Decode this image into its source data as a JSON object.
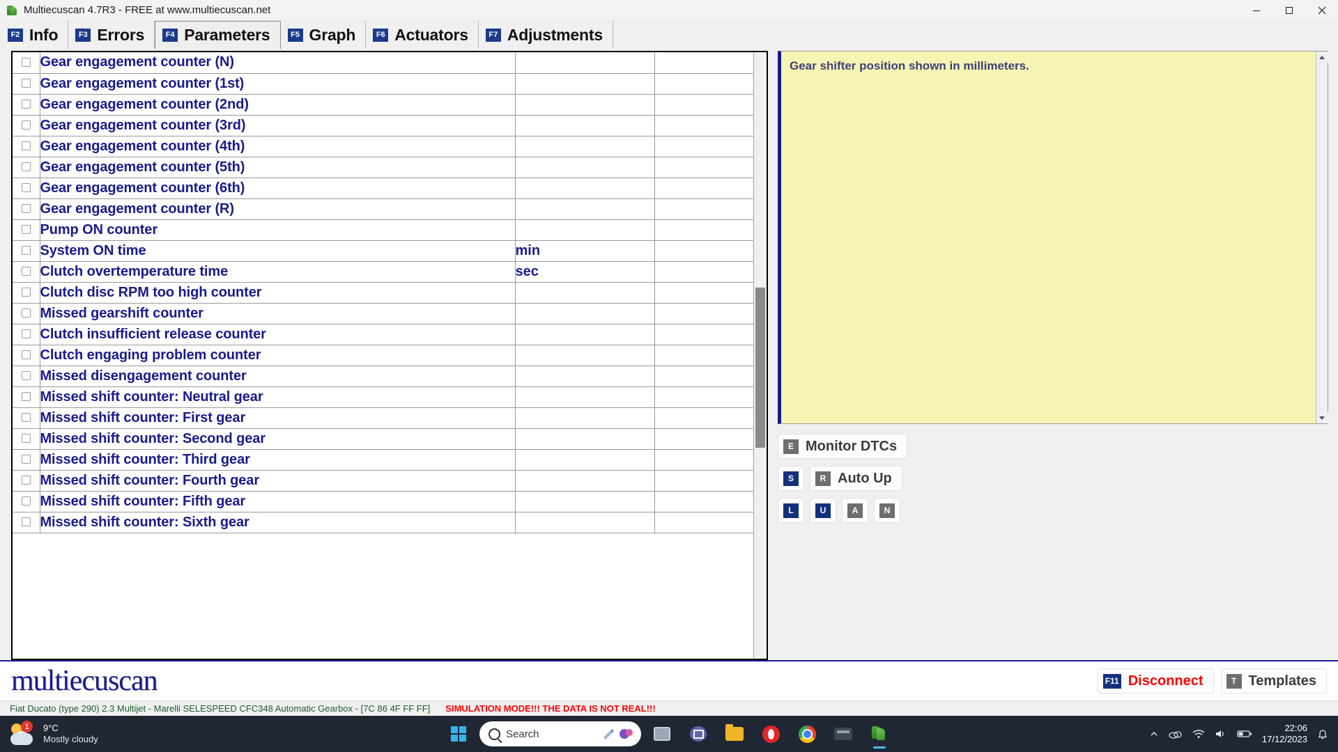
{
  "window": {
    "title": "Multiecuscan 4.7R3 - FREE at www.multiecuscan.net",
    "app_icon": "multiecuscan-leaf-icon",
    "minimize_label": "Minimize",
    "maximize_label": "Maximize",
    "close_label": "Close"
  },
  "tabs": [
    {
      "fkey": "F2",
      "label": "Info",
      "active": false
    },
    {
      "fkey": "F3",
      "label": "Errors",
      "active": false
    },
    {
      "fkey": "F4",
      "label": "Parameters",
      "active": true
    },
    {
      "fkey": "F5",
      "label": "Graph",
      "active": false
    },
    {
      "fkey": "F6",
      "label": "Actuators",
      "active": false
    },
    {
      "fkey": "F7",
      "label": "Adjustments",
      "active": false
    }
  ],
  "grid": {
    "rows": [
      {
        "checked": false,
        "name": "Gear engagement counter (N)",
        "value": "",
        "unit": ""
      },
      {
        "checked": false,
        "name": "Gear engagement counter (1st)",
        "value": "",
        "unit": ""
      },
      {
        "checked": false,
        "name": "Gear engagement counter (2nd)",
        "value": "",
        "unit": ""
      },
      {
        "checked": false,
        "name": "Gear engagement counter (3rd)",
        "value": "",
        "unit": ""
      },
      {
        "checked": false,
        "name": "Gear engagement counter (4th)",
        "value": "",
        "unit": ""
      },
      {
        "checked": false,
        "name": "Gear engagement counter (5th)",
        "value": "",
        "unit": ""
      },
      {
        "checked": false,
        "name": "Gear engagement counter (6th)",
        "value": "",
        "unit": ""
      },
      {
        "checked": false,
        "name": "Gear engagement counter (R)",
        "value": "",
        "unit": ""
      },
      {
        "checked": false,
        "name": "Pump ON counter",
        "value": "",
        "unit": ""
      },
      {
        "checked": false,
        "name": "System ON time",
        "value": "",
        "unit": "min"
      },
      {
        "checked": false,
        "name": "Clutch overtemperature time",
        "value": "",
        "unit": "sec"
      },
      {
        "checked": false,
        "name": "Clutch disc RPM too high counter",
        "value": "",
        "unit": ""
      },
      {
        "checked": false,
        "name": "Missed gearshift counter",
        "value": "",
        "unit": ""
      },
      {
        "checked": false,
        "name": "Clutch insufficient release counter",
        "value": "",
        "unit": ""
      },
      {
        "checked": false,
        "name": "Clutch engaging problem counter",
        "value": "",
        "unit": ""
      },
      {
        "checked": false,
        "name": "Missed disengagement counter",
        "value": "",
        "unit": ""
      },
      {
        "checked": false,
        "name": "Missed shift counter: Neutral gear",
        "value": "",
        "unit": ""
      },
      {
        "checked": false,
        "name": "Missed shift counter: First gear",
        "value": "",
        "unit": ""
      },
      {
        "checked": false,
        "name": "Missed shift counter: Second gear",
        "value": "",
        "unit": ""
      },
      {
        "checked": false,
        "name": "Missed shift counter: Third gear",
        "value": "",
        "unit": ""
      },
      {
        "checked": false,
        "name": "Missed shift counter: Fourth gear",
        "value": "",
        "unit": ""
      },
      {
        "checked": false,
        "name": "Missed shift counter: Fifth gear",
        "value": "",
        "unit": ""
      },
      {
        "checked": false,
        "name": "Missed shift counter: Sixth gear",
        "value": "",
        "unit": ""
      }
    ]
  },
  "tooltip": {
    "text": "Gear shifter position shown in millimeters.",
    "background": "#f7f5b4",
    "accent": "#15188c"
  },
  "right_actions": {
    "monitor_dtcs": {
      "key": "E",
      "label": "Monitor DTCs",
      "key_color": "gray"
    },
    "stop": {
      "key": "S",
      "label": "",
      "key_color": "navy"
    },
    "auto_up": {
      "key": "R",
      "label": "Auto Up",
      "key_color": "gray"
    },
    "log": {
      "key": "L",
      "label": "",
      "key_color": "navy"
    },
    "up": {
      "key": "U",
      "label": "",
      "key_color": "navy"
    },
    "a_button": {
      "key": "A",
      "label": "",
      "key_color": "gray"
    },
    "n_button": {
      "key": "N",
      "label": "",
      "key_color": "gray"
    }
  },
  "bottom": {
    "brand": "multiecuscan",
    "disconnect": {
      "key": "F11",
      "label": "Disconnect",
      "key_color": "navy",
      "label_color": "#ff0000"
    },
    "templates": {
      "key": "T",
      "label": "Templates",
      "key_color": "gray",
      "label_color": "#3b3b3b"
    }
  },
  "status": {
    "vehicle": "Fiat Ducato (type 290) 2.3 Multijet - Marelli SELESPEED CFC348 Automatic Gearbox - [7C 86 4F FF FF]",
    "simulation": "SIMULATION MODE!!! THE DATA IS NOT REAL!!!",
    "vehicle_color": "#1e5c2e",
    "simulation_color": "#ff0000"
  },
  "taskbar": {
    "weather": {
      "temperature": "9°C",
      "description": "Mostly cloudy",
      "badge": "1",
      "icon": "partly-cloudy-icon"
    },
    "search": {
      "placeholder": "Search",
      "value": "Search"
    },
    "apps": [
      {
        "name": "start-button",
        "icon": "windows-logo-icon"
      },
      {
        "name": "search-pill",
        "icon": "search-icon"
      },
      {
        "name": "task-view-button",
        "icon": "task-view-icon"
      },
      {
        "name": "teams-button",
        "icon": "teams-icon"
      },
      {
        "name": "file-explorer-button",
        "icon": "folder-icon"
      },
      {
        "name": "opera-button",
        "icon": "opera-icon"
      },
      {
        "name": "chrome-button",
        "icon": "chrome-icon"
      },
      {
        "name": "ecu-tool-button",
        "icon": "ecu-icon"
      },
      {
        "name": "multiecuscan-button",
        "icon": "multiecuscan-icon"
      }
    ],
    "tray": {
      "chevron": "show-hidden-icons",
      "cloud": "onedrive-icon",
      "wifi": "wifi-icon",
      "volume": "volume-icon",
      "battery": "battery-icon",
      "notifications": "bell-icon"
    },
    "clock": {
      "time": "22:06",
      "date": "17/12/2023"
    }
  }
}
